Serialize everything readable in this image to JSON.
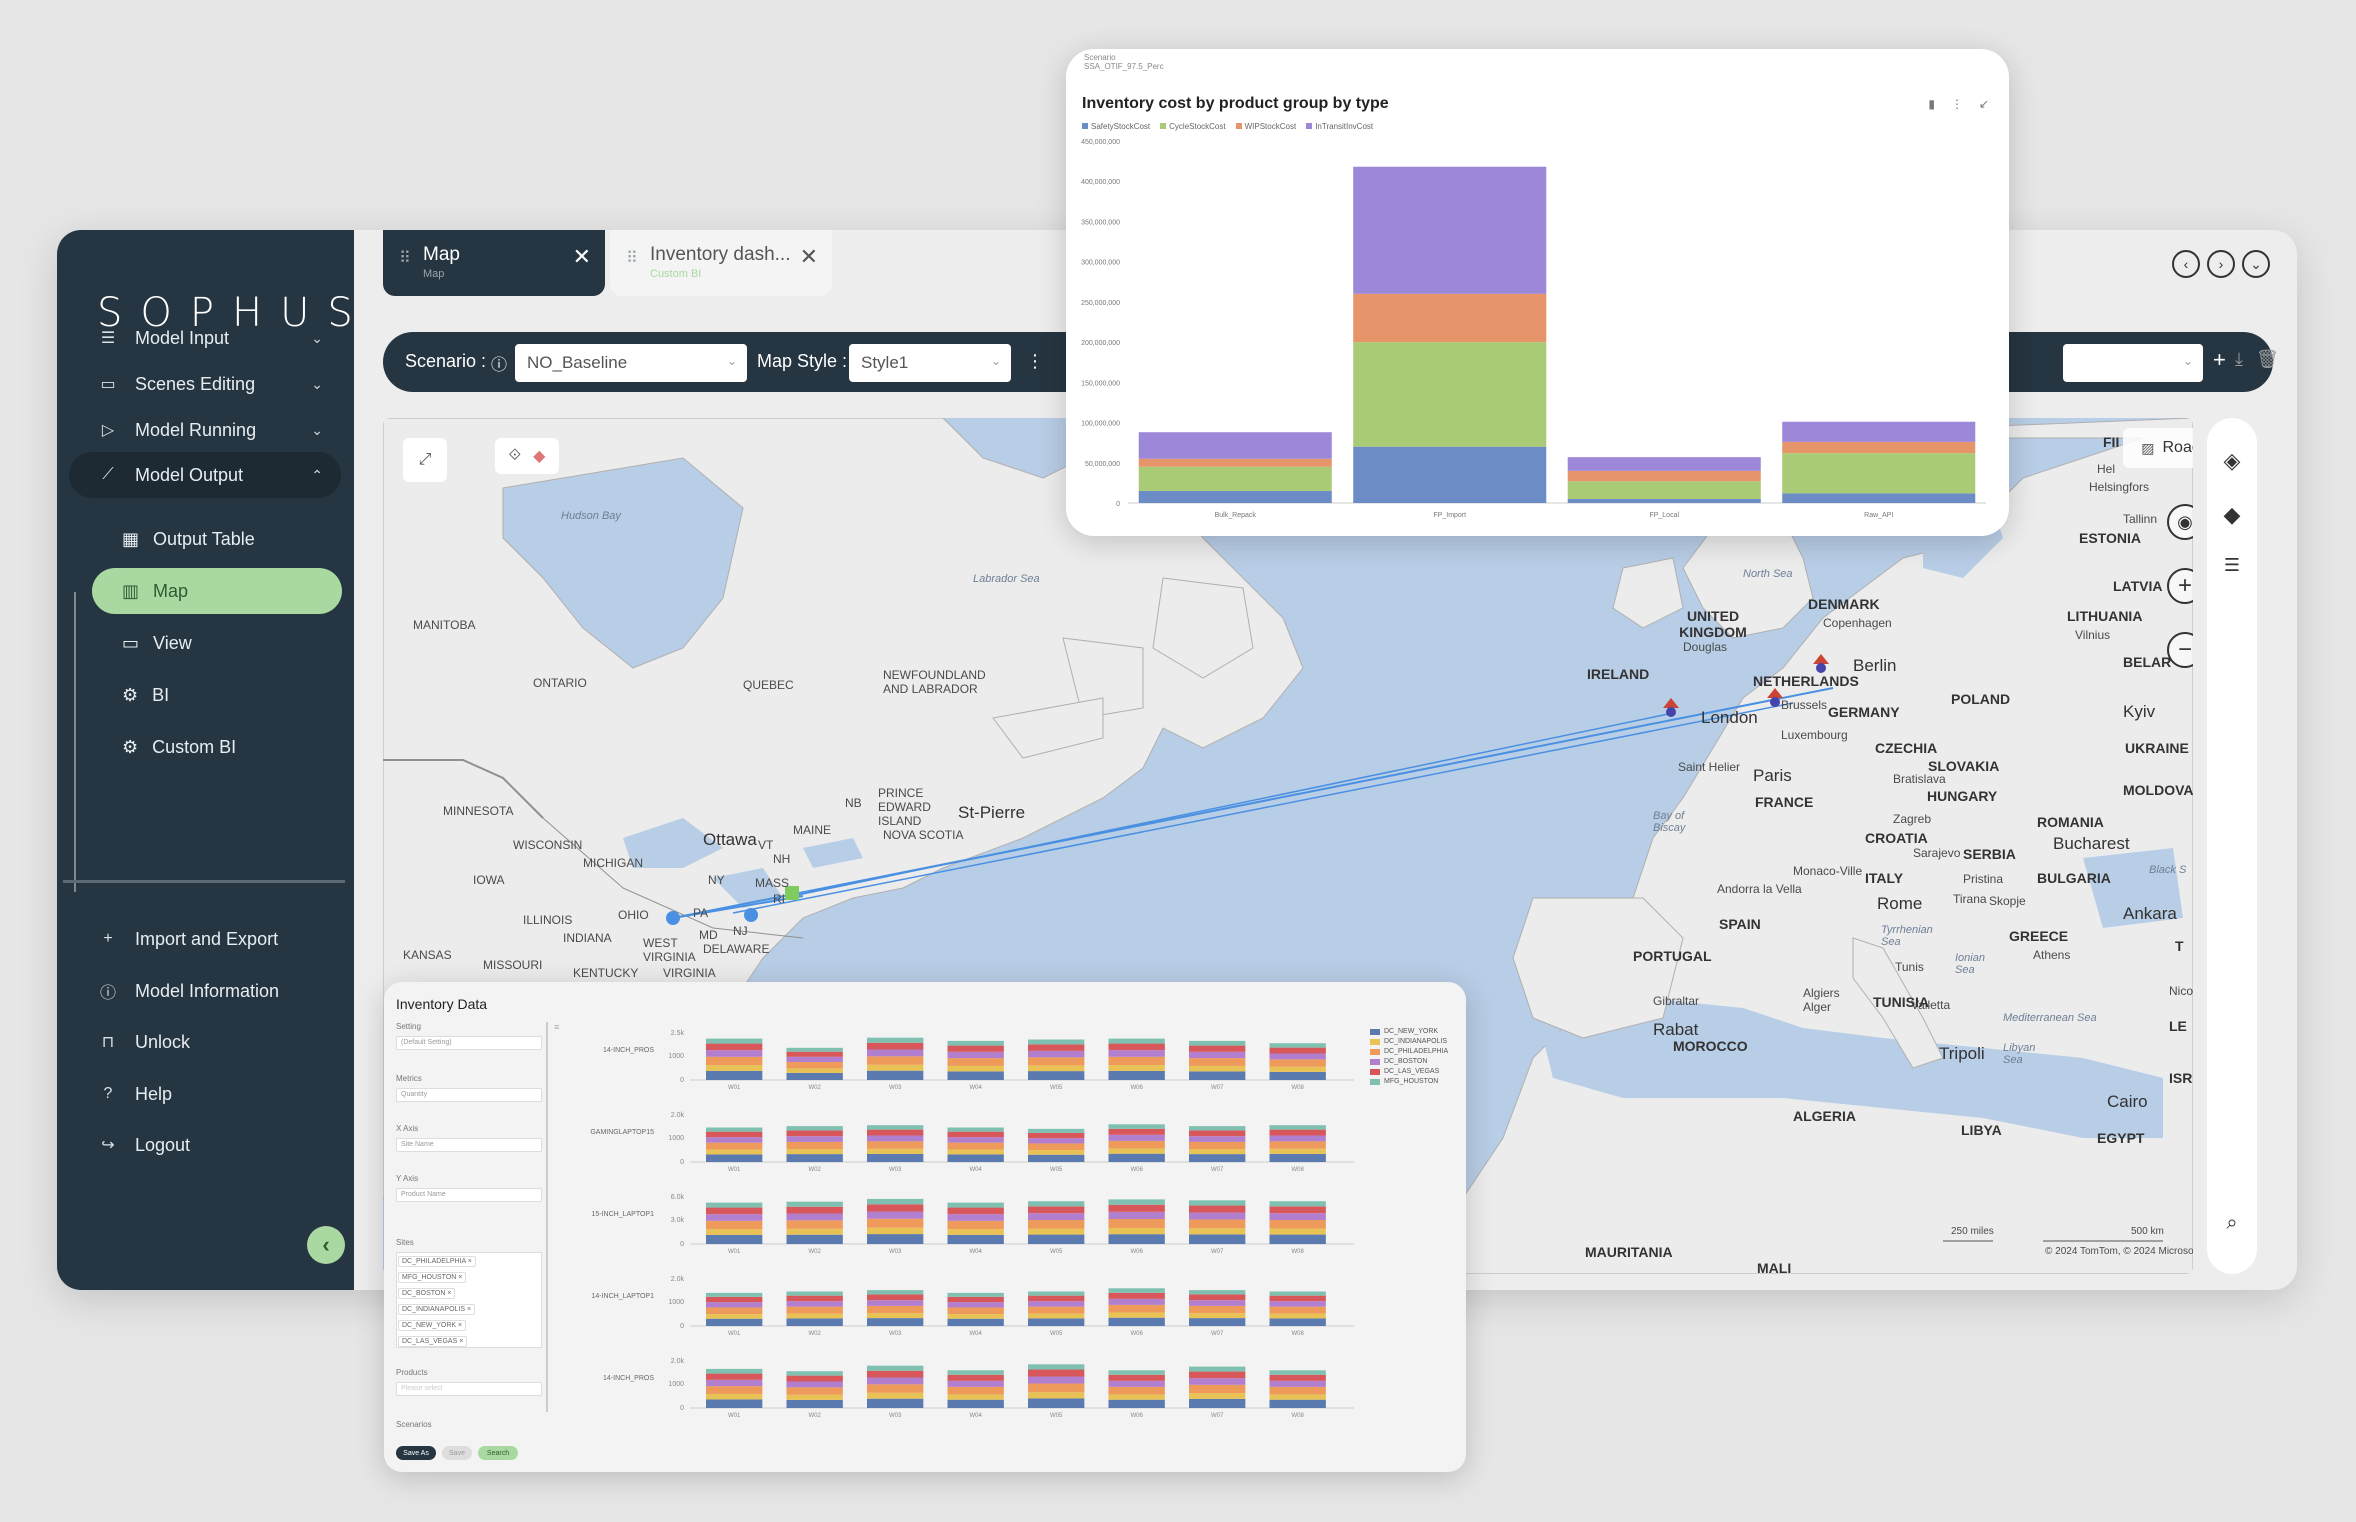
{
  "sidebar": {
    "logo": "SOPHUS",
    "items": [
      {
        "label": "Model Input",
        "icon": "list-icon",
        "chevron": "v"
      },
      {
        "label": "Scenes Editing",
        "icon": "monitor-edit-icon",
        "chevron": "v"
      },
      {
        "label": "Model Running",
        "icon": "play-icon",
        "chevron": "v"
      },
      {
        "label": "Model Output",
        "icon": "chart-line-icon",
        "chevron": "^"
      }
    ],
    "subitems": [
      {
        "label": "Output Table",
        "icon": "table-icon"
      },
      {
        "label": "Map",
        "icon": "map-icon"
      },
      {
        "label": "View",
        "icon": "view-icon"
      },
      {
        "label": "BI",
        "icon": "bi-icon"
      },
      {
        "label": "Custom BI",
        "icon": "custom-bi-icon"
      }
    ],
    "bottom": [
      {
        "label": "Import and Export",
        "icon": "plus-icon"
      },
      {
        "label": "Model Information",
        "icon": "info-icon"
      },
      {
        "label": "Unlock",
        "icon": "lock-icon"
      },
      {
        "label": "Help",
        "icon": "help-icon"
      },
      {
        "label": "Logout",
        "icon": "logout-icon"
      }
    ]
  },
  "tabs": [
    {
      "title": "Map",
      "subtitle": "Map"
    },
    {
      "title": "Inventory dash...",
      "subtitle": "Custom BI"
    }
  ],
  "toolbar": {
    "scenario_label": "Scenario :",
    "scenario_value": "NO_Baseline",
    "map_style_label": "Map Style :",
    "map_style_value": "Style1"
  },
  "map": {
    "style_label": "Road",
    "copyright": "© 2024 TomTom, © 2024 Microsoft Corporation",
    "scale_miles": "250 miles",
    "scale_km": "500 km",
    "labels": {
      "hudson_bay": "Hudson Bay",
      "labrador_sea": "Labrador Sea",
      "manitoba": "MANITOBA",
      "ontario": "ONTARIO",
      "quebec": "QUEBEC",
      "newfoundland": "NEWFOUNDLAND AND LABRADOR",
      "minnesota": "MINNESOTA",
      "wisconsin": "WISCONSIN",
      "michigan": "MICHIGAN",
      "iowa": "IOWA",
      "illinois": "ILLINOIS",
      "indiana": "INDIANA",
      "ohio": "OHIO",
      "kansas": "KANSAS",
      "missouri": "MISSOURI",
      "kentucky": "KENTUCKY",
      "wv": "WEST VIRGINIA",
      "virginia": "VIRGINIA",
      "ottawa": "Ottawa",
      "ny": "NY",
      "pa": "PA",
      "nj": "NJ",
      "md": "MD",
      "delaware": "DELAWARE",
      "vt": "VT",
      "nh": "NH",
      "maine": "MAINE",
      "mass": "MASS",
      "ri": "RI",
      "nb": "NB",
      "pei": "PRINCE EDWARD ISLAND",
      "ns": "NOVA SCOTIA",
      "st_pierre": "St-Pierre",
      "north_sea": "North Sea",
      "uk": "UNITED KINGDOM",
      "douglas": "Douglas",
      "ireland": "IRELAND",
      "denmark": "DENMARK",
      "copenhagen": "Copenhagen",
      "netherlands": "NETHERLANDS",
      "berlin": "Berlin",
      "london": "London",
      "brussels": "Brussels",
      "germany": "GERMANY",
      "luxembourg": "Luxembourg",
      "poland": "POLAND",
      "czechia": "CZECHIA",
      "slovakia": "SLOVAKIA",
      "bratislava": "Bratislava",
      "hungary": "HUNGARY",
      "saint_helier": "Saint Helier",
      "paris": "Paris",
      "france": "FRANCE",
      "bay_biscay": "Bay of Biscay",
      "zagreb": "Zagreb",
      "croatia": "CROATIA",
      "sarajevo": "Sarajevo",
      "serbia": "SERBIA",
      "romania": "ROMANIA",
      "bucharest": "Bucharest",
      "bulgaria": "BULGARIA",
      "monaco": "Monaco-Ville",
      "italy": "ITALY",
      "andorra": "Andorra la Vella",
      "spain": "SPAIN",
      "rome": "Rome",
      "tirana": "Tirana",
      "skopje": "Skopje",
      "pristina": "Pristina",
      "greece": "GREECE",
      "athens": "Athens",
      "ankara": "Ankara",
      "portugal": "PORTUGAL",
      "tyrrhenian": "Tyrrhenian Sea",
      "ionian": "Ionian Sea",
      "tunis": "Tunis",
      "valletta": "Valletta",
      "gibraltar": "Gibraltar",
      "algiers": "Algiers Alger",
      "tunisia": "TUNISIA",
      "rabat": "Rabat",
      "morocco": "MOROCCO",
      "mediterranean": "Mediterranean Sea",
      "tripoli": "Tripoli",
      "libyan_sea": "Libyan Sea",
      "algeria": "ALGERIA",
      "libya": "LIBYA",
      "egypt": "EGYPT",
      "cairo": "Cairo",
      "mauritania": "MAURITANIA",
      "mali": "MALI",
      "estonia": "ESTONIA",
      "tallinn": "Tallinn",
      "latvia": "LATVIA",
      "lithuania": "LITHUANIA",
      "vilnius": "Vilnius",
      "belar": "BELAR",
      "kyiv": "Kyiv",
      "ukraine": "UKRAINE",
      "moldova": "MOLDOVA",
      "nicosia": "Nicos",
      "helsinki": "Helsingfors",
      "fi": "FII",
      "hel": "Hel",
      "black_sea": "Black S",
      "le": "LE",
      "isr": "ISR",
      "t": "T"
    }
  },
  "chart_card": {
    "scenario_caption": "Scenario",
    "scenario_value": "SSA_OTIF_97.5_Perc",
    "legend_colors": [
      "#6b8cc4",
      "#aacb75",
      "#e6956b",
      "#9d87d9"
    ],
    "chart_data": {
      "type": "bar",
      "title": "Inventory cost by product group by type",
      "categories": [
        "Bulk_Repack",
        "FP_Import",
        "FP_Local",
        "Raw_API"
      ],
      "series": [
        {
          "name": "SafetyStockCost",
          "values": [
            15000000,
            70000000,
            5000000,
            12000000
          ]
        },
        {
          "name": "CycleStockCost",
          "values": [
            30000000,
            130000000,
            22000000,
            50000000
          ]
        },
        {
          "name": "WIPStockCost",
          "values": [
            10000000,
            60000000,
            13000000,
            14000000
          ]
        },
        {
          "name": "InTransitInvCost",
          "values": [
            33000000,
            158000000,
            17000000,
            25000000
          ]
        }
      ],
      "ylim": [
        0,
        450000000
      ],
      "yticks": [
        "0",
        "50,000,000",
        "100,000,000",
        "150,000,000",
        "200,000,000",
        "250,000,000",
        "300,000,000",
        "350,000,000",
        "400,000,000",
        "450,000,000"
      ],
      "grid": false,
      "legend": "top-left"
    }
  },
  "inventory_card": {
    "title": "Inventory Data",
    "filters": {
      "setting_label": "Setting",
      "setting_value": "(Default Setting)",
      "metrics_label": "Metrics",
      "metrics_value": "Quantity",
      "xaxis_label": "X Axis",
      "xaxis_value": "Site Name",
      "yaxis_label": "Y Axis",
      "yaxis_value": "Product Name",
      "sites_label": "Sites",
      "sites_chips": [
        "DC_PHILADELPHIA ×",
        "MFG_HOUSTON ×",
        "DC_BOSTON ×",
        "DC_INDIANAPOLIS ×",
        "DC_NEW_YORK ×",
        "DC_LAS_VEGAS ×"
      ],
      "products_label": "Products",
      "products_placeholder": "Please select",
      "scenarios_label": "Scenarios"
    },
    "buttons": {
      "save_as": "Save As",
      "save": "Save",
      "search": "Search"
    },
    "legend": [
      {
        "name": "DC_NEW_YORK",
        "color": "#5b7bb0"
      },
      {
        "name": "DC_INDIANAPOLIS",
        "color": "#e8c255"
      },
      {
        "name": "DC_PHILADELPHIA",
        "color": "#ee9a5a"
      },
      {
        "name": "DC_BOSTON",
        "color": "#b27fcf"
      },
      {
        "name": "DC_LAS_VEGAS",
        "color": "#d8575a"
      },
      {
        "name": "MFG_HOUSTON",
        "color": "#7fc0b0"
      }
    ],
    "chart_data": {
      "type": "bar",
      "rows": [
        "14-INCH_PROS",
        "GAMINGLAPTOP15",
        "15-INCH_LAPTOP1",
        "14-INCH_LAPTOP1",
        "14-INCH_PROS"
      ],
      "row_ytop": [
        "2.5k",
        "2.0k",
        "6.0k",
        "2.0k",
        "2.0k"
      ],
      "row_ymid": [
        "1000",
        "1000",
        "3.0k",
        "1000",
        "1000"
      ],
      "categories": [
        "W01",
        "W02",
        "W03",
        "W04",
        "W05",
        "W06",
        "W07",
        "W08"
      ],
      "heights": [
        [
          0.9,
          0.7,
          0.92,
          0.85,
          0.88,
          0.9,
          0.85,
          0.8
        ],
        [
          0.75,
          0.78,
          0.8,
          0.75,
          0.72,
          0.82,
          0.78,
          0.8
        ],
        [
          0.9,
          0.92,
          0.98,
          0.9,
          0.93,
          0.97,
          0.95,
          0.93
        ],
        [
          0.72,
          0.75,
          0.78,
          0.72,
          0.75,
          0.82,
          0.78,
          0.75
        ],
        [
          0.85,
          0.8,
          0.92,
          0.82,
          0.95,
          0.82,
          0.9,
          0.82
        ]
      ]
    }
  }
}
